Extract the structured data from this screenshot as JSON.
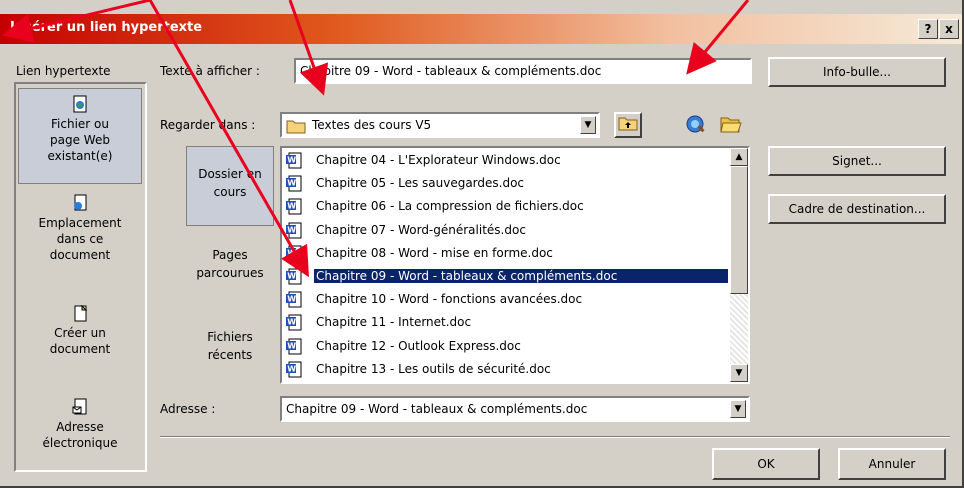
{
  "window": {
    "title": "Insérer un lien hypertexte",
    "help_glyph": "?",
    "close_glyph": "x"
  },
  "left_nav": {
    "heading": "Lien hypertexte",
    "items": [
      {
        "label": "Fichier ou page Web existant(e)",
        "icon": "existing-file-icon",
        "selected": true
      },
      {
        "label": "Emplacement dans ce document",
        "icon": "place-in-document-icon",
        "selected": false
      },
      {
        "label": "Créer un document",
        "icon": "new-document-icon",
        "selected": false
      },
      {
        "label": "Adresse électronique",
        "icon": "email-address-icon",
        "selected": false
      }
    ]
  },
  "text_to_display": {
    "label": "Texte à afficher :",
    "value": "Chapitre 09 - Word - tableaux & compléments.doc"
  },
  "look_in": {
    "label": "Regarder dans :",
    "value": "Textes des cours V5",
    "folder_icon": "folder-icon"
  },
  "tool_icons": [
    "up-folder-icon",
    "browse-web-icon",
    "browse-file-icon"
  ],
  "tabs": [
    {
      "label": "Dossier en cours",
      "selected": true
    },
    {
      "label": "Pages parcourues",
      "selected": false
    },
    {
      "label": "Fichiers récents",
      "selected": false
    }
  ],
  "files": [
    "Chapitre 04 - L'Explorateur Windows.doc",
    "Chapitre 05 - Les sauvegardes.doc",
    "Chapitre 06 - La compression de fichiers.doc",
    "Chapitre 07 - Word-généralités.doc",
    "Chapitre 08 - Word - mise en forme.doc",
    "Chapitre 09 - Word - tableaux & compléments.doc",
    "Chapitre 10 - Word - fonctions avancées.doc",
    "Chapitre 11 - Internet.doc",
    "Chapitre 12 - Outlook Express.doc",
    "Chapitre 13 - Les outils de sécurité.doc"
  ],
  "selected_file_index": 5,
  "address": {
    "label": "Adresse :",
    "value": "Chapitre 09 - Word - tableaux & compléments.doc"
  },
  "buttons": {
    "screen_tip": "Info-bulle...",
    "bookmark": "Signet...",
    "target_frame": "Cadre de destination...",
    "ok": "OK",
    "cancel": "Annuler"
  },
  "colors": {
    "selection": "#0a246a",
    "annotation_arrows": "#e8001c",
    "title_start": "#c40000"
  }
}
